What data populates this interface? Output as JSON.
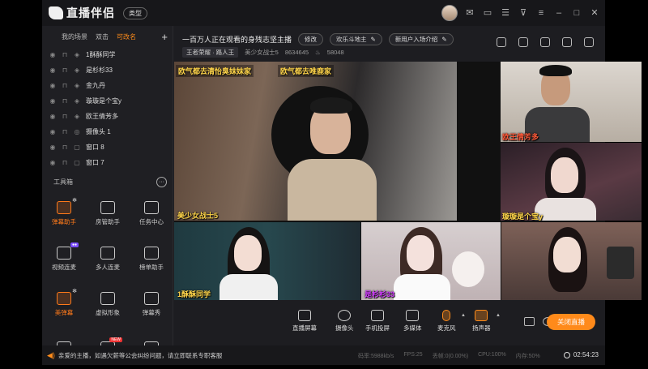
{
  "app": {
    "brand": "直播伴侣",
    "type_button": "类型"
  },
  "titlebar_icons": [
    "mail-icon",
    "screen-icon",
    "notes-icon",
    "filter-icon",
    "menu-icon",
    "minimize-icon",
    "maximize-icon",
    "close-icon"
  ],
  "sidebar": {
    "tabs": [
      "我的场景",
      "双击",
      "可改名"
    ],
    "active_tab": "可改名",
    "add_label": "+",
    "scenes": [
      {
        "name": "1酥酥同学",
        "kind": "media"
      },
      {
        "name": "是杉杉33",
        "kind": "media"
      },
      {
        "name": "金九丹",
        "kind": "media"
      },
      {
        "name": "璇璇是个宝y",
        "kind": "media"
      },
      {
        "name": "欧王倩芳多",
        "kind": "media"
      },
      {
        "name": "摄像头 1",
        "kind": "camera"
      },
      {
        "name": "窗口 8",
        "kind": "window"
      },
      {
        "name": "窗口 7",
        "kind": "window"
      }
    ],
    "toolbox_label": "工具箱",
    "tools": [
      {
        "label": "弹幕助手",
        "active": true,
        "badge": "gear"
      },
      {
        "label": "房管助手",
        "active": false,
        "badge": ""
      },
      {
        "label": "任务中心",
        "active": false,
        "badge": ""
      },
      {
        "label": "视频连麦",
        "active": false,
        "badge": "new-purple"
      },
      {
        "label": "多人连麦",
        "active": false,
        "badge": ""
      },
      {
        "label": "榜单助手",
        "active": false,
        "badge": ""
      },
      {
        "label": "美弹幕",
        "active": true,
        "badge": "gear"
      },
      {
        "label": "虚拟形象",
        "active": false,
        "badge": ""
      },
      {
        "label": "弹幕秀",
        "active": false,
        "badge": ""
      },
      {
        "label": "",
        "active": false,
        "badge": ""
      },
      {
        "label": "",
        "active": false,
        "badge": "new"
      },
      {
        "label": "",
        "active": false,
        "badge": ""
      }
    ]
  },
  "header": {
    "title": "一百万人正在观看的身残志坚主播",
    "edit_label": "修改",
    "category": "欢乐斗地主",
    "entrance_note": "新用户入场介绍",
    "rank": "王者荣耀 · 路人王",
    "host_name": "美少女战士5",
    "host_id": "8634645",
    "likes": "58048"
  },
  "stage": {
    "banners": [
      "欧气都去清怡臭妹妹家",
      "欧气都去唯鹿家"
    ],
    "tiles": [
      {
        "label": "美少女战士5"
      },
      {
        "label": "欧王倩芳多"
      },
      {
        "label": "璇璇是个宝y"
      },
      {
        "label": "1酥酥同学"
      },
      {
        "label": "是杉杉33"
      },
      {
        "label": ""
      }
    ]
  },
  "controls": {
    "items": [
      "直播屏幕",
      "摄像头",
      "手机投屏",
      "多媒体",
      "麦克风",
      "扬声器"
    ],
    "go_live": "关闭直播"
  },
  "status": {
    "message": "亲爱的主播，如遇欠薪等公会纠纷问题，请立即联系专职客服",
    "bitrate": "码率:5988kb/s",
    "fps": "FPS:25",
    "dropped": "丢帧:0(0.00%)",
    "cpu": "CPU:100%",
    "mem": "内存:50%",
    "clock": "02:54:23"
  },
  "colors": {
    "accent": "#ff8a1a",
    "label": "#ffd54a"
  }
}
